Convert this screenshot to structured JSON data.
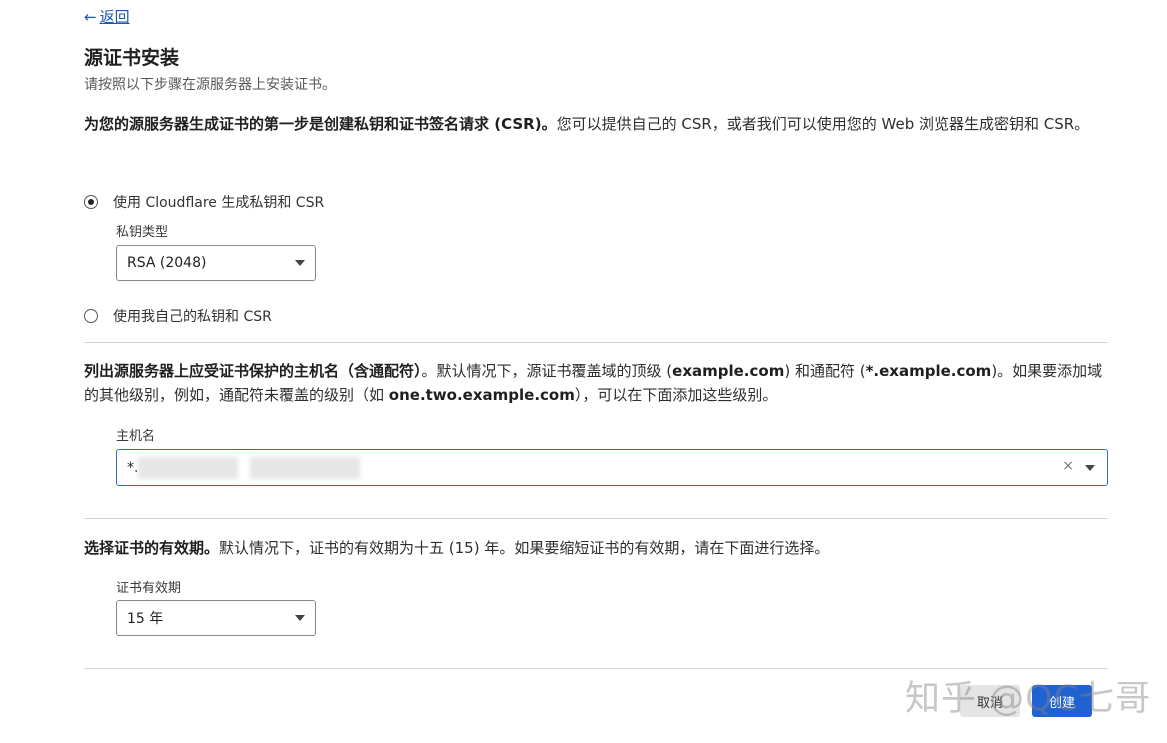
{
  "nav": {
    "back_label": "返回"
  },
  "header": {
    "title": "源证书安装",
    "subtitle": "请按照以下步骤在源服务器上安装证书。"
  },
  "csr_section": {
    "intro_bold": "为您的源服务器生成证书的第一步是创建私钥和证书签名请求 (CSR)。",
    "intro_rest": "您可以提供自己的 CSR，或者我们可以使用您的 Web 浏览器生成密钥和 CSR。",
    "option_cloudflare": "使用 Cloudflare 生成私钥和 CSR",
    "key_type_label": "私钥类型",
    "key_type_value": "RSA (2048)",
    "option_own": "使用我自己的私钥和 CSR"
  },
  "hostname_section": {
    "intro_bold": "列出源服务器上应受证书保护的主机名（含通配符）",
    "intro_p1": "。默认情况下，源证书覆盖域的顶级 (",
    "intro_b1": "example.com",
    "intro_p2": ") 和通配符 (",
    "intro_b2": "*.example.com",
    "intro_p3": ")。如果要添加域的其他级别，例如，通配符未覆盖的级别（如 ",
    "intro_b3": "one.two.example.com",
    "intro_p4": "），可以在下面添加这些级别。",
    "field_label": "主机名",
    "tag_prefix": "*.",
    "clear_symbol": "×"
  },
  "validity_section": {
    "intro_bold": "选择证书的有效期。",
    "intro_rest": "默认情况下，证书的有效期为十五 (15) 年。如果要缩短证书的有效期，请在下面进行选择。",
    "field_label": "证书有效期",
    "value": "15 年"
  },
  "footer": {
    "cancel_label": "取消",
    "create_label": "创建"
  },
  "watermark": "知乎 @QC七哥",
  "colors": {
    "link": "#1b56b8",
    "primary": "#1f63d2",
    "focus_border": "#2f6fd2"
  }
}
